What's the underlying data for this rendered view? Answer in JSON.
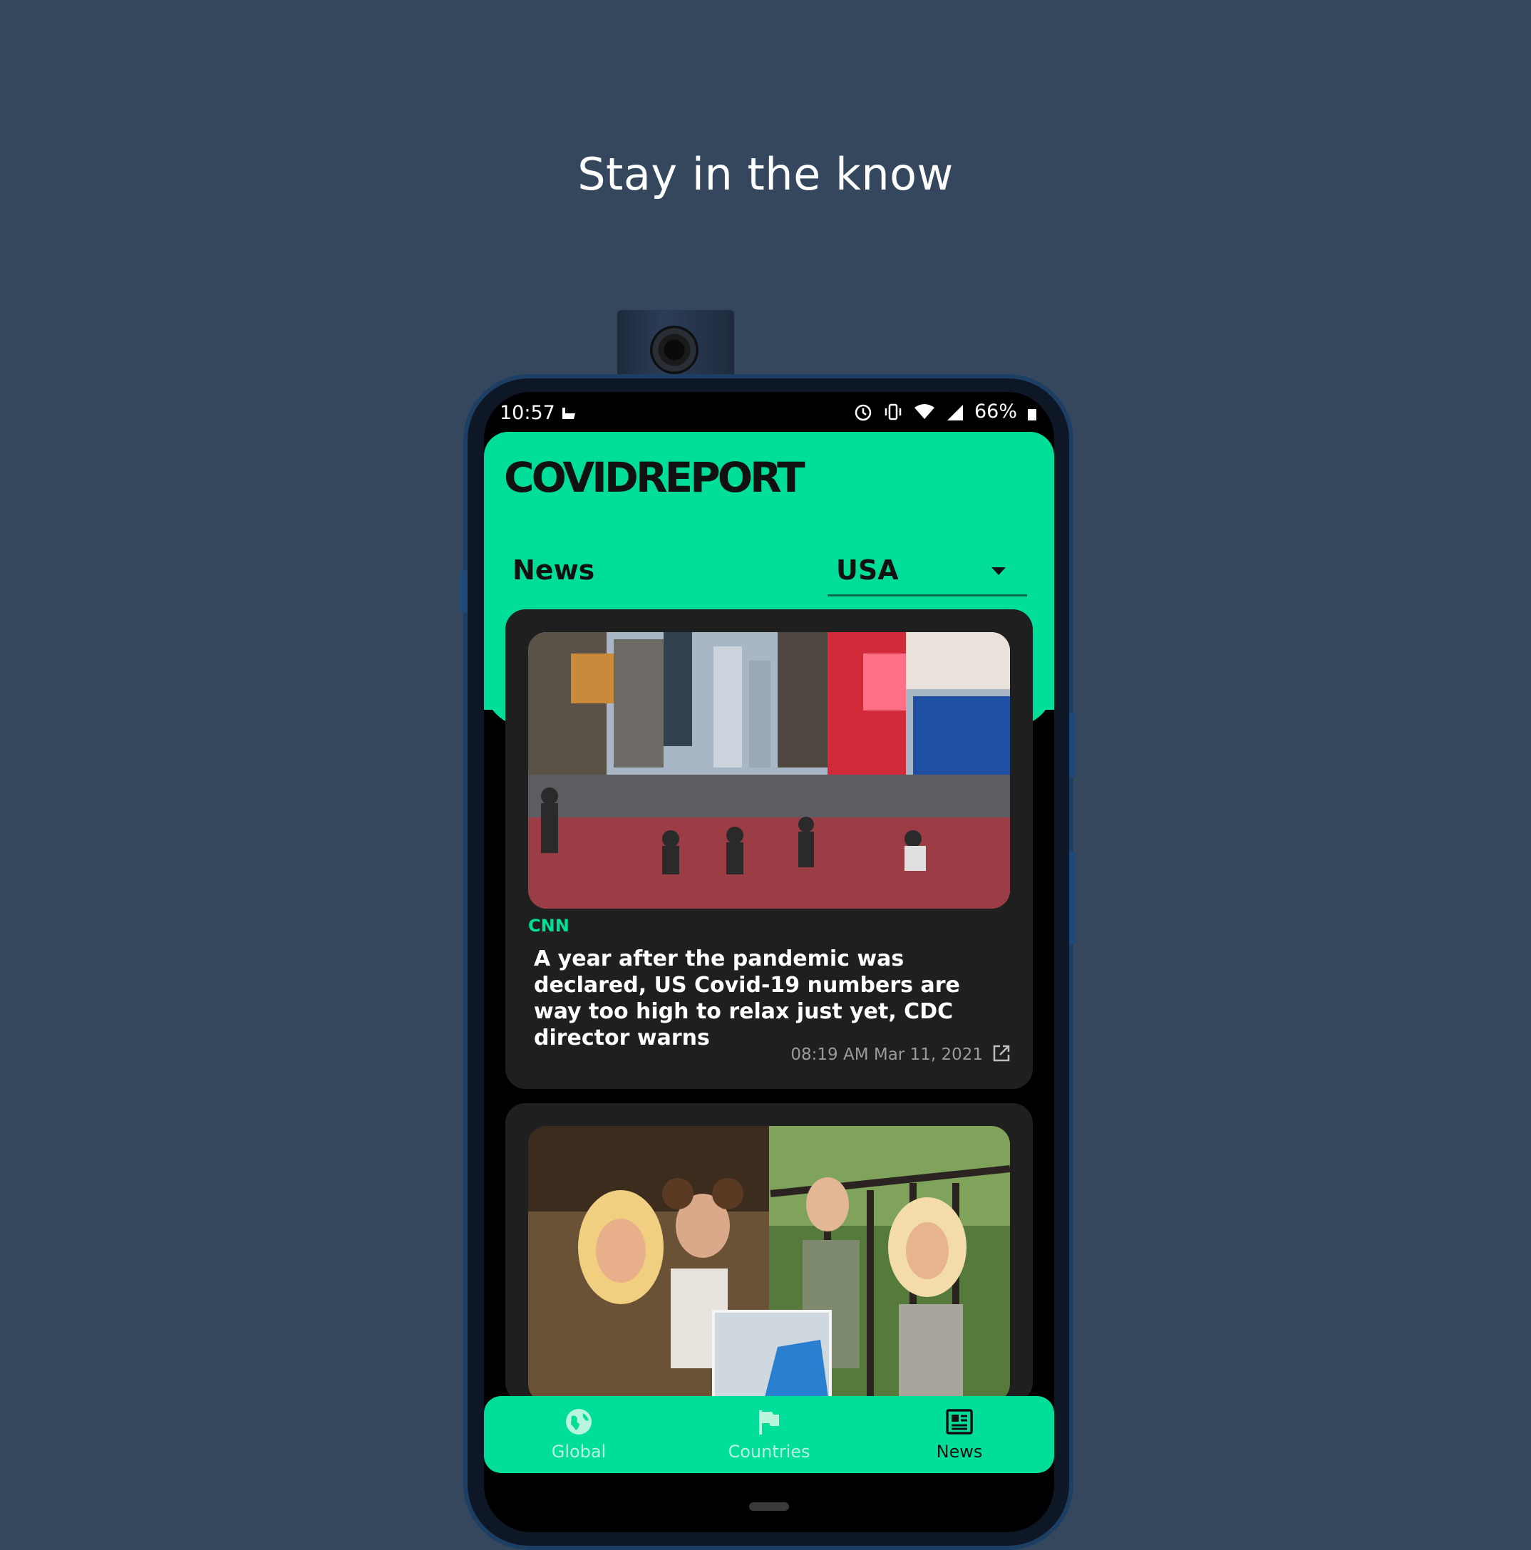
{
  "promo": {
    "headline": "Stay in the know"
  },
  "status_bar": {
    "time": "10:57",
    "battery": "66%"
  },
  "app": {
    "logo": "COVIDREPORT",
    "section_title": "News",
    "country_select": {
      "selected": "USA"
    }
  },
  "articles": [
    {
      "source": "CNN",
      "title": "A year after the pandemic was declared, US Covid-19 numbers are way too high to relax just yet, CDC director warns",
      "date": "08:19 AM Mar 11, 2021",
      "image": "times-square-photo"
    },
    {
      "image": "mother-daughter-photo-collage"
    }
  ],
  "bottom_nav": {
    "items": [
      {
        "label": "Global",
        "icon": "globe-icon",
        "active": false
      },
      {
        "label": "Countries",
        "icon": "flag-icon",
        "active": false
      },
      {
        "label": "News",
        "icon": "newspaper-icon",
        "active": true
      }
    ]
  },
  "colors": {
    "background": "#34475d",
    "accent": "#00de9a",
    "card": "#1f1f1f",
    "source": "#00de9a"
  }
}
